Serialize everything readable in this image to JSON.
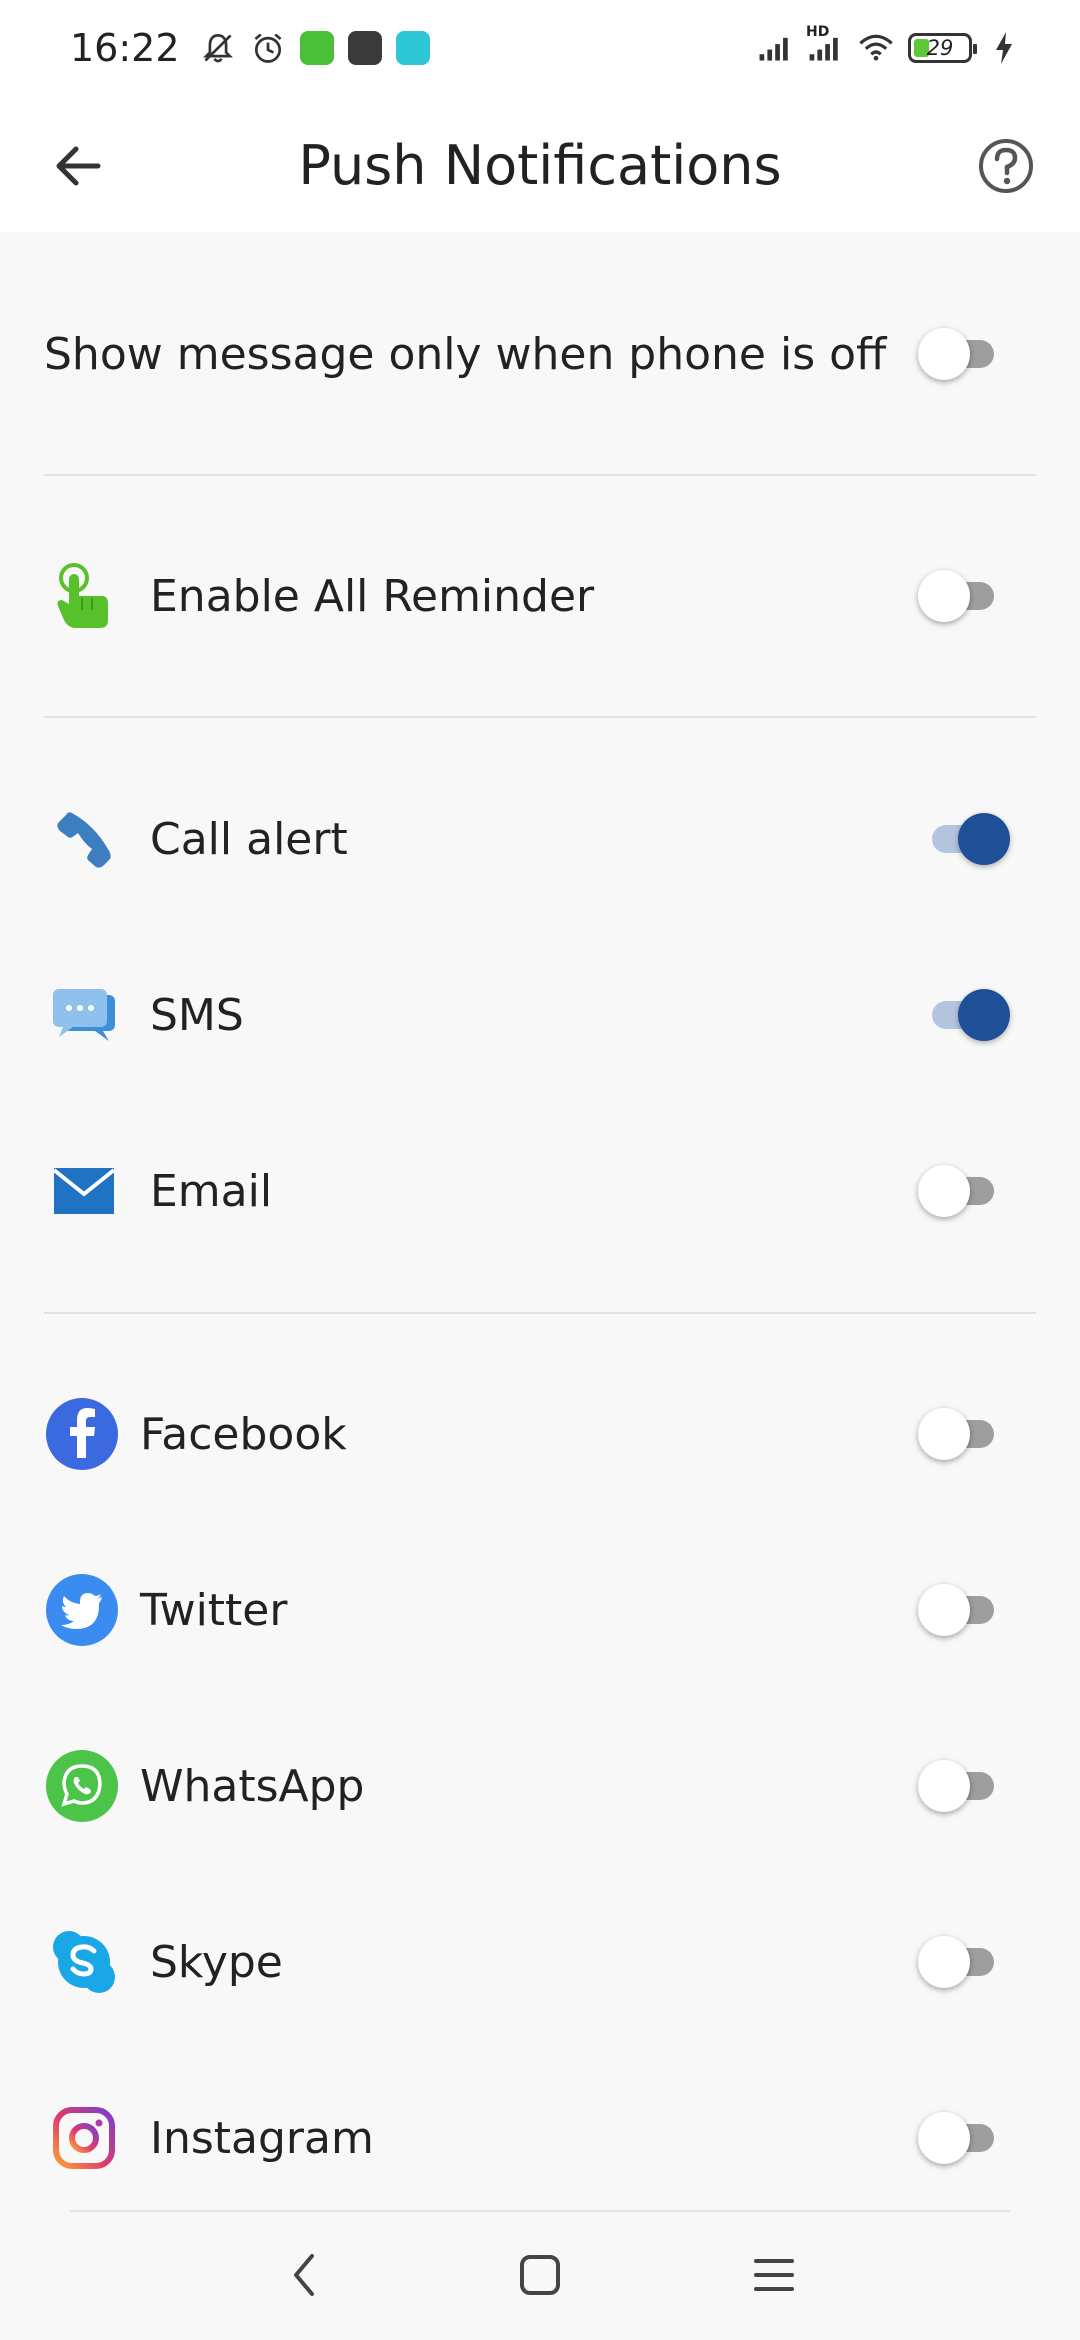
{
  "status_bar": {
    "time": "16:22",
    "battery_level": "29",
    "battery_fraction": 0.29,
    "icons": [
      "mute-icon",
      "alarm-icon",
      "app-green-icon",
      "app-dark-icon",
      "app-teal-icon",
      "signal-icon",
      "hd-signal-icon",
      "wifi-icon",
      "battery-icon",
      "charging-icon"
    ],
    "hd_label": "HD"
  },
  "header": {
    "title": "Push Notifications",
    "back_icon": "arrow-left-icon",
    "help_icon": "help-circle-icon"
  },
  "settings": {
    "show_message_off": {
      "label": "Show message only when phone is off",
      "enabled": false
    },
    "enable_all": {
      "label": "Enable All Reminder",
      "enabled": false,
      "icon": "hand-tap-icon"
    },
    "call_alert": {
      "label": "Call alert",
      "enabled": true,
      "icon": "phone-icon"
    },
    "sms": {
      "label": "SMS",
      "enabled": true,
      "icon": "sms-icon"
    },
    "email": {
      "label": "Email",
      "enabled": false,
      "icon": "email-icon"
    },
    "facebook": {
      "label": "Facebook",
      "enabled": false,
      "icon": "facebook-icon"
    },
    "twitter": {
      "label": "Twitter",
      "enabled": false,
      "icon": "twitter-icon"
    },
    "whatsapp": {
      "label": "WhatsApp",
      "enabled": false,
      "icon": "whatsapp-icon"
    },
    "skype": {
      "label": "Skype",
      "enabled": false,
      "icon": "skype-icon"
    },
    "instagram": {
      "label": "Instagram",
      "enabled": false,
      "icon": "instagram-icon"
    }
  },
  "nav": {
    "back_icon": "nav-back-icon",
    "home_icon": "nav-home-icon",
    "menu_icon": "nav-menu-icon"
  },
  "colors": {
    "toggle_on": "#1f4f96",
    "toggle_track_on": "#b4c4df",
    "toggle_off_track": "#9e9e9e",
    "facebook": "#3b69e0",
    "twitter": "#3b8cf0",
    "whatsapp": "#4cc44a",
    "skype": "#1aa7e6",
    "battery_fill": "#5cc83a"
  }
}
